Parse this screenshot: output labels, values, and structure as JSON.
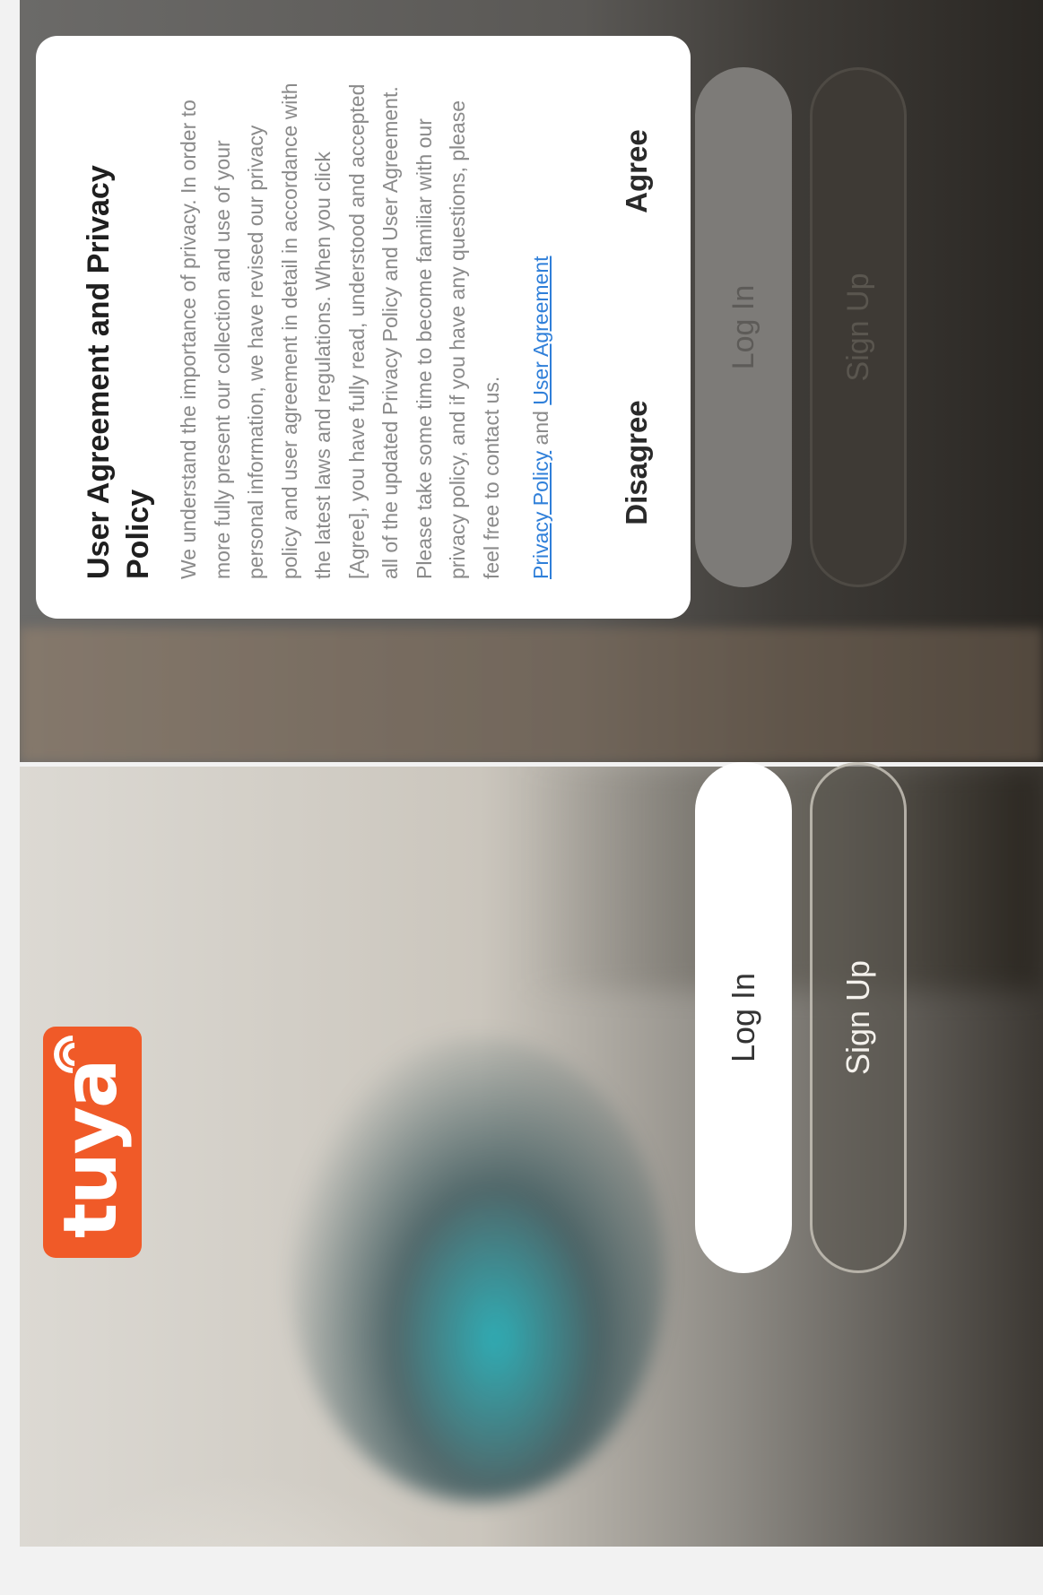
{
  "brand": {
    "logo_text": "tuya",
    "logo_color": "#f05a28"
  },
  "welcome": {
    "login_label": "Log In",
    "signup_label": "Sign Up"
  },
  "privacy_dialog": {
    "title": "User Agreement and Privacy Policy",
    "body": "We understand the importance of privacy. In order to more fully present our collection and use of your personal information, we have revised our privacy policy and user agreement in detail in accordance with the latest laws and regulations. When you click [Agree], you have fully read, understood and accepted all of the updated Privacy Policy and User Agreement. Please take some time to become familiar with our privacy policy, and if you have any questions, please feel free to contact us.",
    "link_privacy": "Privacy Policy",
    "link_joiner": "and",
    "link_user_agreement": "User Agreement",
    "disagree_label": "Disagree",
    "agree_label": "Agree",
    "link_color": "#2f7fd9"
  },
  "background_buttons": {
    "login_label": "Log In",
    "signup_label": "Sign Up"
  }
}
